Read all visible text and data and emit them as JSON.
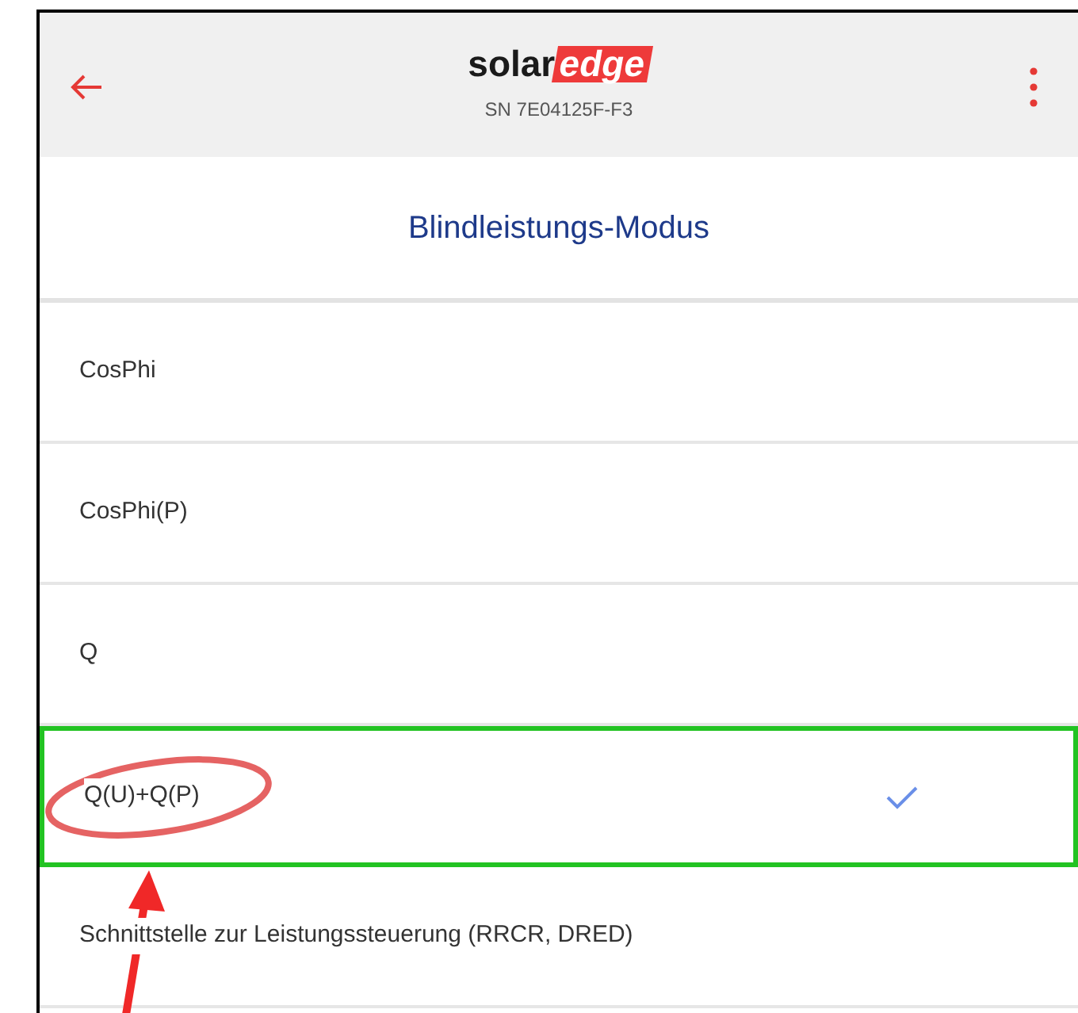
{
  "header": {
    "logo": {
      "word": "solar",
      "highlight": "edge"
    },
    "serial": "SN 7E04125F-F3"
  },
  "title": "Blindleistungs-Modus",
  "items": [
    {
      "label": "CosPhi",
      "selected": false,
      "highlighted": false,
      "circled": false
    },
    {
      "label": "CosPhi(P)",
      "selected": false,
      "highlighted": false,
      "circled": false
    },
    {
      "label": "Q",
      "selected": false,
      "highlighted": false,
      "circled": false
    },
    {
      "label": "Q(U)+Q(P)",
      "selected": true,
      "highlighted": true,
      "circled": true
    },
    {
      "label": "Schnittstelle zur Leistungssteuerung (RRCR, DRED)",
      "selected": false,
      "highlighted": false,
      "circled": false
    }
  ]
}
